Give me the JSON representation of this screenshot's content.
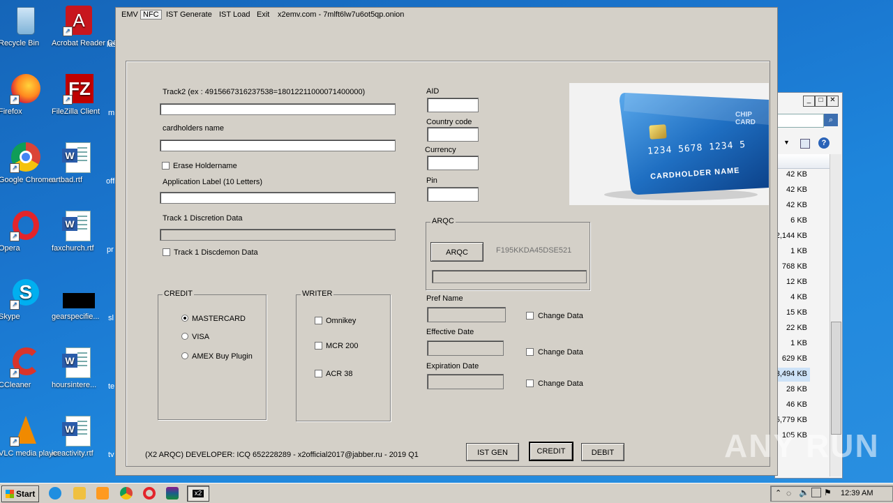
{
  "desktop": {
    "icons": [
      {
        "label": "Recycle Bin"
      },
      {
        "label": "Acrobat Reader DC"
      },
      {
        "label": "Firefox"
      },
      {
        "label": "FileZilla Client"
      },
      {
        "label": "Google Chrome"
      },
      {
        "label": "artbad.rtf"
      },
      {
        "label": "Opera"
      },
      {
        "label": "faxchurch.rtf"
      },
      {
        "label": "Skype"
      },
      {
        "label": "gearspecifie..."
      },
      {
        "label": "CCleaner"
      },
      {
        "label": "hoursintere..."
      },
      {
        "label": "VLC media player"
      },
      {
        "label": "iceactivity.rtf"
      }
    ],
    "partial_labels": [
      "las",
      "m",
      "offi",
      "pr",
      "sl",
      "te",
      "tv"
    ]
  },
  "explorer": {
    "sizes": [
      "42 KB",
      "42 KB",
      "42 KB",
      "6 KB",
      "2,144 KB",
      "1 KB",
      "768 KB",
      "12 KB",
      "4 KB",
      "15 KB",
      "22 KB",
      "1 KB",
      "629 KB",
      "3,494 KB",
      "28 KB",
      "46 KB",
      "5,779 KB",
      "105 KB"
    ]
  },
  "app": {
    "menu": {
      "emv": "EMV",
      "nfc": "NFC",
      "ist_generate": "IST Generate",
      "ist_load": "IST Load",
      "exit": "Exit",
      "site": "x2emv.com - 7mlft6lw7u6ot5qp.onion"
    },
    "track2_label": "Track2 (ex : 4915667316237538=18012211000071400000)",
    "cardholder_label": "cardholders name",
    "erase_holdername": "Erase Holdername",
    "app_label_label": "Application Label (10 Letters)",
    "track1_label": "Track 1 Discretion Data",
    "track1_check": "Track 1 Discdemon Data",
    "credit": {
      "title": "CREDIT",
      "options": [
        "MASTERCARD",
        "VISA",
        "AMEX Buy Plugin"
      ],
      "selected": "MASTERCARD"
    },
    "writer": {
      "title": "WRITER",
      "options": [
        "Omnikey",
        "MCR 200",
        "ACR 38"
      ]
    },
    "aid_label": "AID",
    "country_label": "Country code",
    "currency_label": "Currency",
    "pin_label": "Pin",
    "arqc": {
      "title": "ARQC",
      "button": "ARQC",
      "value": "F195KKDA45DSE521"
    },
    "pref_name_label": "Pref Name",
    "effective_date_label": "Effective Date",
    "expiration_date_label": "Expiration Date",
    "change_data": "Change Data",
    "card": {
      "number": "1234 5678 1234 5",
      "holder": "CARDHOLDER NAME",
      "brand": "CHIP CARD"
    },
    "footer": "(X2 ARQC) DEVELOPER: ICQ 652228289 - x2official2017@jabber.ru - 2019 Q1",
    "buttons": {
      "ist_gen": "IST GEN",
      "credit": "CREDIT",
      "debit": "DEBIT"
    }
  },
  "taskbar": {
    "start": "Start",
    "active_task": "x2",
    "clock": "12:39 AM"
  },
  "watermark": "ANY RUN"
}
